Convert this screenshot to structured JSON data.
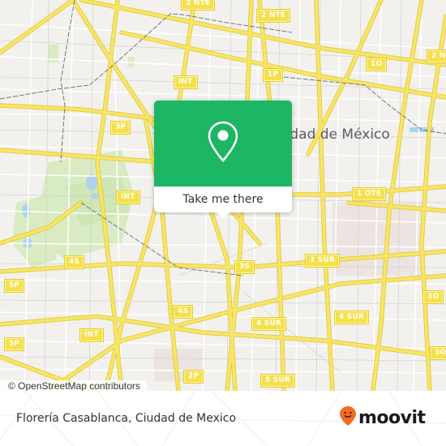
{
  "map": {
    "city_label": "Ciudad de México",
    "attribution": "© OpenStreetMap contributors",
    "colors": {
      "background": "#f2f1ee",
      "road_major": "#f5e04a",
      "road_minor": "#ffffff",
      "park": "#d8ebc2",
      "water": "#aad3f0",
      "rail": "#777777"
    },
    "shields": [
      {
        "label": "2 NTE"
      },
      {
        "label": "2 NTE"
      },
      {
        "label": "2 N"
      },
      {
        "label": "INT"
      },
      {
        "label": "1P"
      },
      {
        "label": "1O"
      },
      {
        "label": "3P"
      },
      {
        "label": "INT"
      },
      {
        "label": "1 OTE"
      },
      {
        "label": "4S"
      },
      {
        "label": "5P"
      },
      {
        "label": "3S"
      },
      {
        "label": "3 SUR"
      },
      {
        "label": "5P"
      },
      {
        "label": "3O"
      },
      {
        "label": "4S"
      },
      {
        "label": "INT"
      },
      {
        "label": "4 SUR"
      },
      {
        "label": "4 SUR"
      },
      {
        "label": "3O"
      },
      {
        "label": "2P"
      },
      {
        "label": "5 SUR"
      }
    ]
  },
  "popup": {
    "icon": "map-pin-icon",
    "accent_color": "#1db665",
    "cta_label": "Take me there"
  },
  "footer": {
    "place_name": "Florería Casablanca, Ciudad de Mexico",
    "brand": "moovit",
    "brand_color": "#f26b21"
  }
}
